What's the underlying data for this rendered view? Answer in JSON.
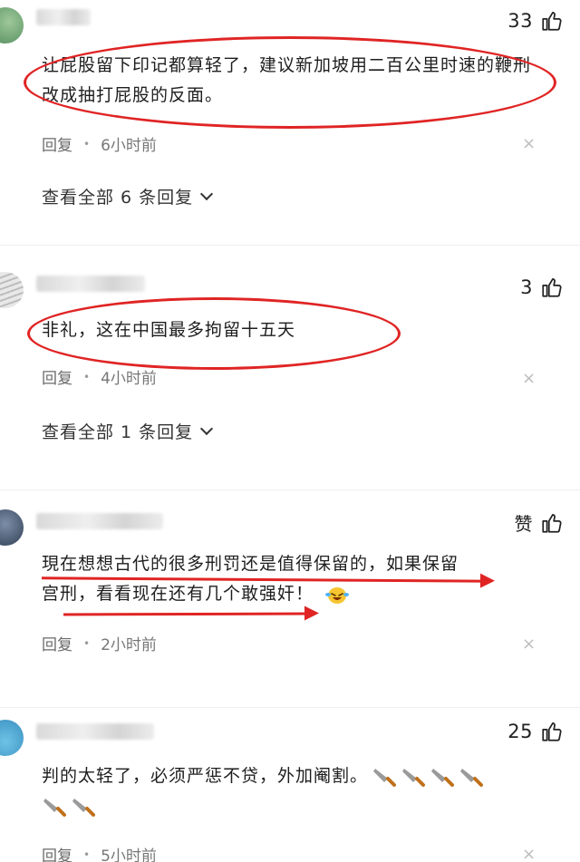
{
  "comments": [
    {
      "likes": "33",
      "text": "让屁股留下印记都算轻了，建议新加坡用二百公里时速的鞭刑改成抽打屁股的反面。",
      "reply_label": "回复",
      "time": "6小时前",
      "view_replies": "查看全部 6 条回复"
    },
    {
      "likes": "3",
      "text": "非礼，这在中国最多拘留十五天",
      "reply_label": "回复",
      "time": "4小时前",
      "view_replies": "查看全部 1 条回复"
    },
    {
      "likes": "赞",
      "text_line1": "現在想想古代的很多刑罚还是值得保留的，如果保留",
      "text_line2": "宫刑，看看现在还有几个敢强奸！",
      "reply_label": "回复",
      "time": "2小时前"
    },
    {
      "likes": "25",
      "text": "判的太轻了，必须严惩不贷，外加阉割。",
      "reply_label": "回复",
      "time": "5小时前"
    }
  ],
  "icons": {
    "like": "thumbs-up-icon",
    "close": "close-icon",
    "chevron": "chevron-down-icon",
    "emoji": "laughing-crying-emoji-icon",
    "knife": "kitchen-knife-emoji-icon"
  },
  "colors": {
    "annotation": "#e02424",
    "meta_text": "#6a6a6a"
  }
}
